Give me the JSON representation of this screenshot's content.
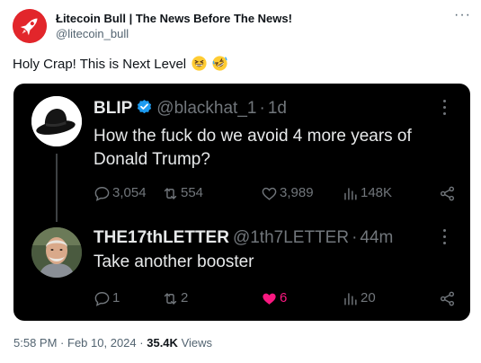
{
  "outer": {
    "display_name": "Łitecoin Bull | The News Before The News!",
    "handle": "@litecoin_bull",
    "text": "Holy Crap! This is Next Level",
    "emojis": [
      "grinning-squinting-face",
      "rolling-on-floor-laughing"
    ],
    "more_label": "···"
  },
  "embedded": {
    "tweet1": {
      "display_name": "BLIP",
      "verified": true,
      "handle": "@blackhat_1",
      "time": "1d",
      "text": "How the fuck do we avoid 4 more years of Donald Trump?",
      "replies": "3,054",
      "reposts": "554",
      "likes": "3,989",
      "views": "148K"
    },
    "tweet2": {
      "display_name": "THE17thLETTER",
      "handle": "@1th7LETTER",
      "time": "44m",
      "text": "Take another booster",
      "replies": "1",
      "reposts": "2",
      "likes": "6",
      "liked": true,
      "views": "20"
    },
    "separator": "·"
  },
  "footer": {
    "time": "5:58 PM",
    "date": "Feb 10, 2024",
    "sep": "·",
    "views_count": "35.4K",
    "views_label": "Views"
  },
  "colors": {
    "card_bg": "#000000",
    "like_pink": "#f91880",
    "verified_blue": "#1d9bf0",
    "muted": "#71767b",
    "brand_red": "#e2262b"
  }
}
